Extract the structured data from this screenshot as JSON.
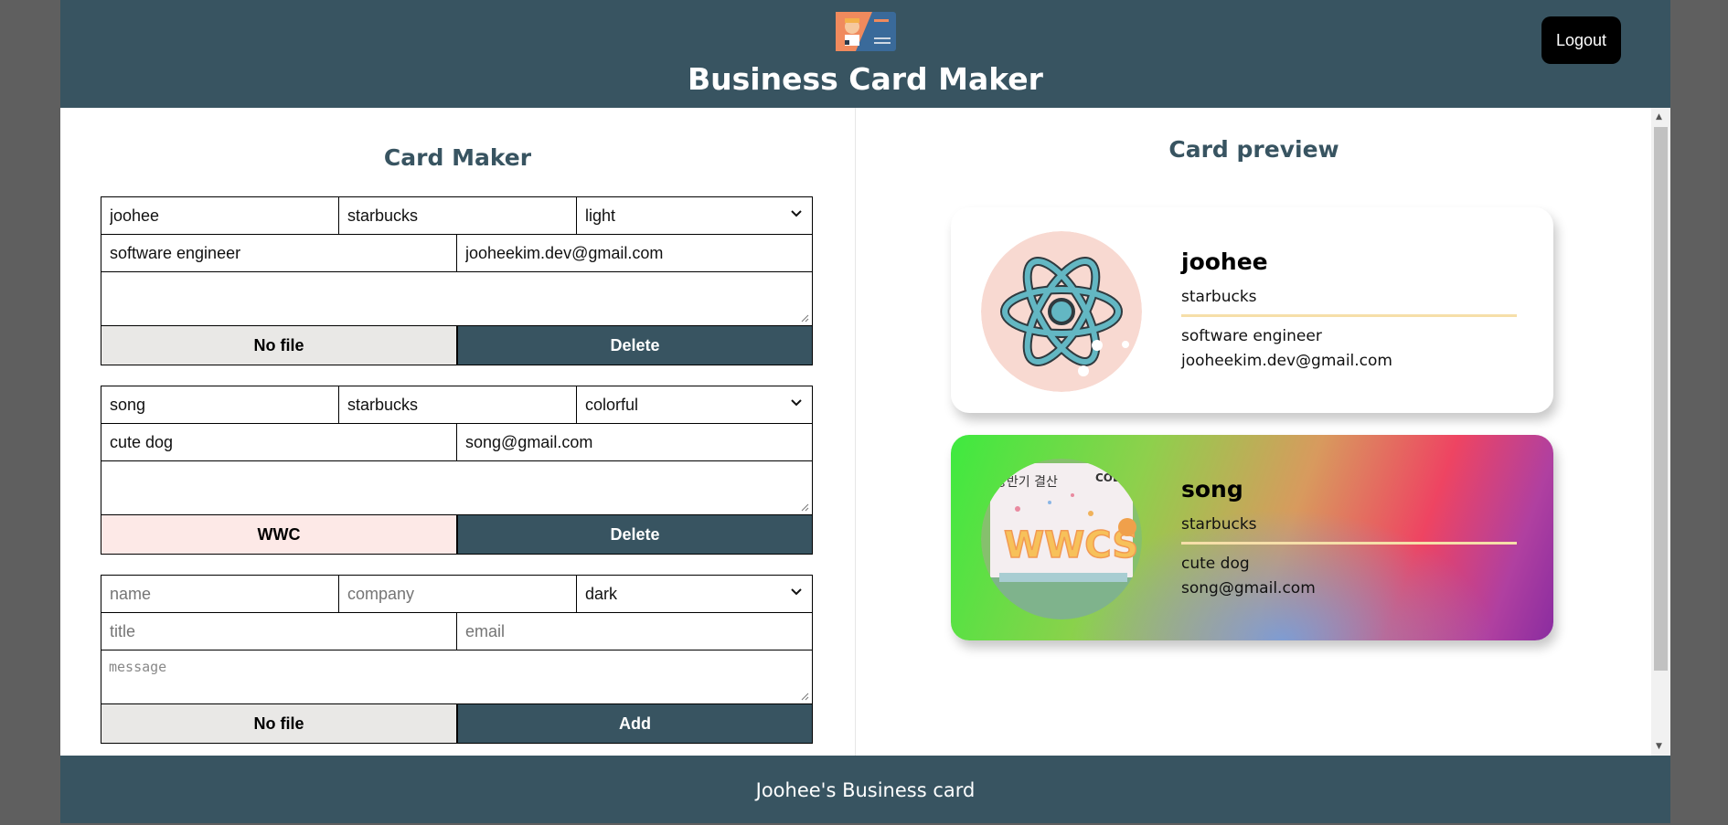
{
  "header": {
    "title": "Business Card Maker",
    "logout_label": "Logout"
  },
  "maker": {
    "title": "Card Maker",
    "cards": [
      {
        "name": "joohee",
        "company": "starbucks",
        "theme": "light",
        "title": "software engineer",
        "email": "jooheekim.dev@gmail.com",
        "message": "",
        "file_label": "No file",
        "action_label": "Delete"
      },
      {
        "name": "song",
        "company": "starbucks",
        "theme": "colorful",
        "title": "cute dog",
        "email": "song@gmail.com",
        "message": "",
        "file_label": "WWC",
        "action_label": "Delete"
      }
    ],
    "add_form": {
      "name_placeholder": "name",
      "company_placeholder": "company",
      "theme": "dark",
      "title_placeholder": "title",
      "email_placeholder": "email",
      "message_placeholder": "message",
      "file_label": "No file",
      "action_label": "Add"
    }
  },
  "preview": {
    "title": "Card preview",
    "cards": [
      {
        "name": "joohee",
        "company": "starbucks",
        "title": "software engineer",
        "email": "jooheekim.dev@gmail.com",
        "theme": "light"
      },
      {
        "name": "song",
        "company": "starbucks",
        "title": "cute dog",
        "email": "song@gmail.com",
        "theme": "colorful"
      }
    ]
  },
  "footer": {
    "text": "Joohee's Business card"
  },
  "colors": {
    "primary": "#385461",
    "accent_line": "#f6dfa9",
    "avatar_bg": "#f8d9d1"
  }
}
